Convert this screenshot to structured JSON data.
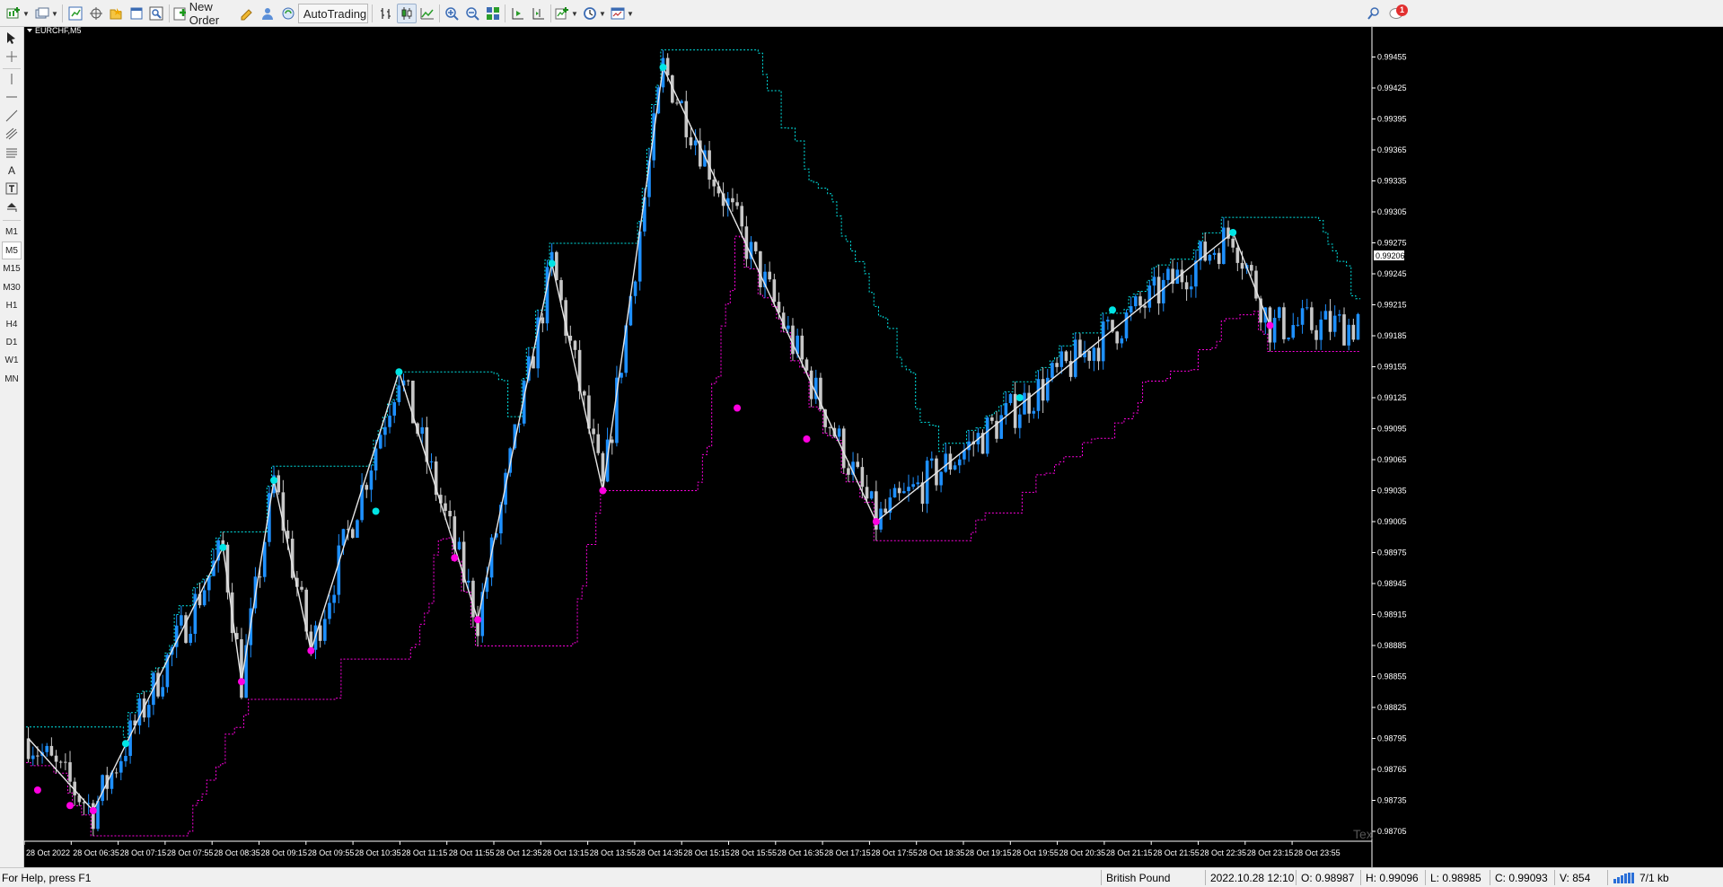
{
  "toolbar": {
    "new_order_label": "New Order",
    "autotrading_label": "AutoTrading",
    "notification_badge": "1"
  },
  "sidebar": {
    "timeframes": [
      "M1",
      "M5",
      "M15",
      "M30",
      "H1",
      "H4",
      "D1",
      "W1",
      "MN"
    ],
    "active_timeframe": "M5"
  },
  "chart": {
    "symbol_label": "EURCHF,M5",
    "current_price": "0.99206",
    "watermark": "Tex",
    "colors": {
      "background": "#000000",
      "bull_candle": "#1e90ff",
      "bear_candle": "#c8c8c8",
      "upper_channel": "#00e5e5",
      "lower_channel": "#ff00e0",
      "zigzag": "#e6e6e6",
      "axis_text": "#ffffff"
    }
  },
  "chart_data": {
    "type": "candlestick",
    "symbol": "EURCHF",
    "timeframe": "M5",
    "ylim": [
      0.98705,
      0.99465
    ],
    "y_ticks": [
      "0.99455",
      "0.99425",
      "0.99395",
      "0.99365",
      "0.99335",
      "0.99305",
      "0.99275",
      "0.99245",
      "0.99215",
      "0.99185",
      "0.99155",
      "0.99125",
      "0.99095",
      "0.99065",
      "0.99035",
      "0.99005",
      "0.98975",
      "0.98945",
      "0.98915",
      "0.98885",
      "0.98855",
      "0.98825",
      "0.98795",
      "0.98765",
      "0.98735",
      "0.98705"
    ],
    "x_ticks": [
      "28 Oct 2022",
      "28 Oct 06:35",
      "28 Oct 07:15",
      "28 Oct 07:55",
      "28 Oct 08:35",
      "28 Oct 09:15",
      "28 Oct 09:55",
      "28 Oct 10:35",
      "28 Oct 11:15",
      "28 Oct 11:55",
      "28 Oct 12:35",
      "28 Oct 13:15",
      "28 Oct 13:55",
      "28 Oct 14:35",
      "28 Oct 15:15",
      "28 Oct 15:55",
      "28 Oct 16:35",
      "28 Oct 17:15",
      "28 Oct 17:55",
      "28 Oct 18:35",
      "28 Oct 19:15",
      "28 Oct 19:55",
      "28 Oct 20:35",
      "28 Oct 21:15",
      "28 Oct 21:55",
      "28 Oct 22:35",
      "28 Oct 23:15",
      "28 Oct 23:55"
    ],
    "bar_count": 288,
    "zigzag": [
      {
        "bar": 0,
        "price": 0.98795
      },
      {
        "bar": 14,
        "price": 0.98725
      },
      {
        "bar": 42,
        "price": 0.9898
      },
      {
        "bar": 46,
        "price": 0.9885
      },
      {
        "bar": 53,
        "price": 0.99045
      },
      {
        "bar": 61,
        "price": 0.9888
      },
      {
        "bar": 80,
        "price": 0.9915
      },
      {
        "bar": 97,
        "price": 0.9891
      },
      {
        "bar": 113,
        "price": 0.99255
      },
      {
        "bar": 124,
        "price": 0.99035
      },
      {
        "bar": 137,
        "price": 0.99445
      },
      {
        "bar": 183,
        "price": 0.99005
      },
      {
        "bar": 260,
        "price": 0.99285
      },
      {
        "bar": 268,
        "price": 0.99195
      }
    ],
    "swing_highs": [
      {
        "bar": 21,
        "price": 0.9879
      },
      {
        "bar": 42,
        "price": 0.9898
      },
      {
        "bar": 53,
        "price": 0.99045
      },
      {
        "bar": 75,
        "price": 0.99015
      },
      {
        "bar": 80,
        "price": 0.9915
      },
      {
        "bar": 113,
        "price": 0.99255
      },
      {
        "bar": 137,
        "price": 0.99445
      },
      {
        "bar": 214,
        "price": 0.99125
      },
      {
        "bar": 234,
        "price": 0.9921
      },
      {
        "bar": 260,
        "price": 0.99285
      }
    ],
    "swing_lows": [
      {
        "bar": 2,
        "price": 0.98745
      },
      {
        "bar": 9,
        "price": 0.9873
      },
      {
        "bar": 14,
        "price": 0.98725
      },
      {
        "bar": 46,
        "price": 0.9885
      },
      {
        "bar": 61,
        "price": 0.9888
      },
      {
        "bar": 92,
        "price": 0.9897
      },
      {
        "bar": 97,
        "price": 0.9891
      },
      {
        "bar": 124,
        "price": 0.99035
      },
      {
        "bar": 153,
        "price": 0.99115
      },
      {
        "bar": 168,
        "price": 0.99085
      },
      {
        "bar": 183,
        "price": 0.99005
      },
      {
        "bar": 268,
        "price": 0.99195
      }
    ],
    "grid": false
  },
  "status": {
    "help_text": "For Help, press F1",
    "profile": "British Pound",
    "datetime": "2022.10.28 12:10",
    "open": "O: 0.98987",
    "high": "H: 0.99096",
    "low": "L: 0.98985",
    "close": "C: 0.99093",
    "volume": "V: 854",
    "traffic": "7/1 kb"
  }
}
